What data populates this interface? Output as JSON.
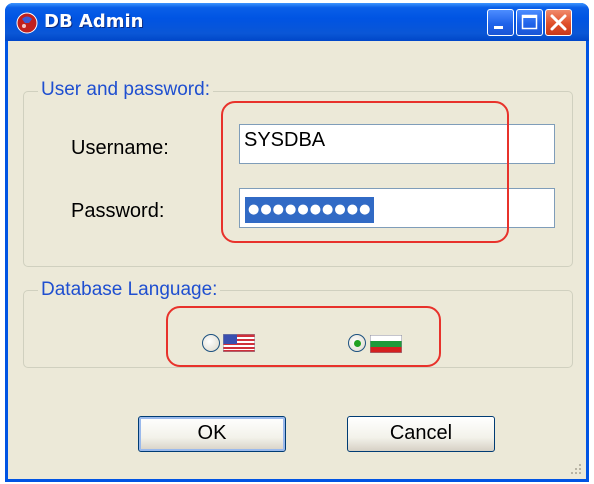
{
  "window": {
    "title": "DB Admin",
    "controls": {
      "minimize": "minimize-icon",
      "maximize": "maximize-icon",
      "close": "close-icon"
    }
  },
  "credentials": {
    "group_label": "User and password:",
    "username_label": "Username:",
    "username_value": "SYSDBA",
    "password_label": "Password:",
    "password_mask": "●●●●●●●●●●"
  },
  "language": {
    "group_label": "Database Language:",
    "options": [
      {
        "icon": "us-flag-icon",
        "selected": false
      },
      {
        "icon": "bg-flag-icon",
        "selected": true
      }
    ]
  },
  "buttons": {
    "ok": "OK",
    "cancel": "Cancel"
  },
  "colors": {
    "title_blue": "#0054e3",
    "annotation_red": "#e8322b",
    "group_label_blue": "#1f4fd0",
    "selection": "#316ac5"
  }
}
